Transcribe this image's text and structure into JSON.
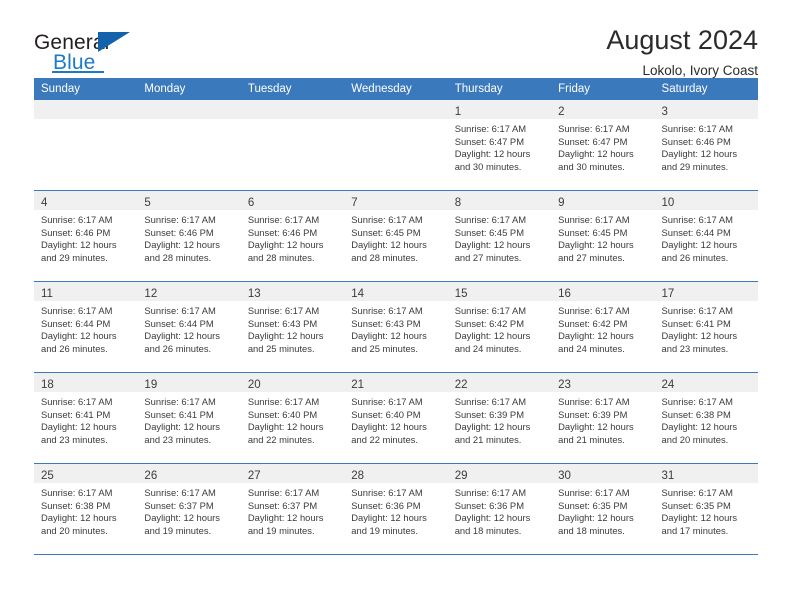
{
  "brand": {
    "name_part1": "General",
    "name_part2": "Blue",
    "flag_icon": "triangle-flag-icon"
  },
  "header": {
    "month_title": "August 2024",
    "location": "Lokolo, Ivory Coast"
  },
  "theme": {
    "header_blue": "#3b79bd",
    "brand_blue": "#1f7ac4",
    "daynum_band": "#f0f0f0",
    "text": "#3b3b3b"
  },
  "calendar": {
    "day_headers": [
      "Sunday",
      "Monday",
      "Tuesday",
      "Wednesday",
      "Thursday",
      "Friday",
      "Saturday"
    ],
    "weeks": [
      [
        {
          "day": "",
          "lines": []
        },
        {
          "day": "",
          "lines": []
        },
        {
          "day": "",
          "lines": []
        },
        {
          "day": "",
          "lines": []
        },
        {
          "day": "1",
          "lines": [
            "Sunrise: 6:17 AM",
            "Sunset: 6:47 PM",
            "Daylight: 12 hours",
            "and 30 minutes."
          ]
        },
        {
          "day": "2",
          "lines": [
            "Sunrise: 6:17 AM",
            "Sunset: 6:47 PM",
            "Daylight: 12 hours",
            "and 30 minutes."
          ]
        },
        {
          "day": "3",
          "lines": [
            "Sunrise: 6:17 AM",
            "Sunset: 6:46 PM",
            "Daylight: 12 hours",
            "and 29 minutes."
          ]
        }
      ],
      [
        {
          "day": "4",
          "lines": [
            "Sunrise: 6:17 AM",
            "Sunset: 6:46 PM",
            "Daylight: 12 hours",
            "and 29 minutes."
          ]
        },
        {
          "day": "5",
          "lines": [
            "Sunrise: 6:17 AM",
            "Sunset: 6:46 PM",
            "Daylight: 12 hours",
            "and 28 minutes."
          ]
        },
        {
          "day": "6",
          "lines": [
            "Sunrise: 6:17 AM",
            "Sunset: 6:46 PM",
            "Daylight: 12 hours",
            "and 28 minutes."
          ]
        },
        {
          "day": "7",
          "lines": [
            "Sunrise: 6:17 AM",
            "Sunset: 6:45 PM",
            "Daylight: 12 hours",
            "and 28 minutes."
          ]
        },
        {
          "day": "8",
          "lines": [
            "Sunrise: 6:17 AM",
            "Sunset: 6:45 PM",
            "Daylight: 12 hours",
            "and 27 minutes."
          ]
        },
        {
          "day": "9",
          "lines": [
            "Sunrise: 6:17 AM",
            "Sunset: 6:45 PM",
            "Daylight: 12 hours",
            "and 27 minutes."
          ]
        },
        {
          "day": "10",
          "lines": [
            "Sunrise: 6:17 AM",
            "Sunset: 6:44 PM",
            "Daylight: 12 hours",
            "and 26 minutes."
          ]
        }
      ],
      [
        {
          "day": "11",
          "lines": [
            "Sunrise: 6:17 AM",
            "Sunset: 6:44 PM",
            "Daylight: 12 hours",
            "and 26 minutes."
          ]
        },
        {
          "day": "12",
          "lines": [
            "Sunrise: 6:17 AM",
            "Sunset: 6:44 PM",
            "Daylight: 12 hours",
            "and 26 minutes."
          ]
        },
        {
          "day": "13",
          "lines": [
            "Sunrise: 6:17 AM",
            "Sunset: 6:43 PM",
            "Daylight: 12 hours",
            "and 25 minutes."
          ]
        },
        {
          "day": "14",
          "lines": [
            "Sunrise: 6:17 AM",
            "Sunset: 6:43 PM",
            "Daylight: 12 hours",
            "and 25 minutes."
          ]
        },
        {
          "day": "15",
          "lines": [
            "Sunrise: 6:17 AM",
            "Sunset: 6:42 PM",
            "Daylight: 12 hours",
            "and 24 minutes."
          ]
        },
        {
          "day": "16",
          "lines": [
            "Sunrise: 6:17 AM",
            "Sunset: 6:42 PM",
            "Daylight: 12 hours",
            "and 24 minutes."
          ]
        },
        {
          "day": "17",
          "lines": [
            "Sunrise: 6:17 AM",
            "Sunset: 6:41 PM",
            "Daylight: 12 hours",
            "and 23 minutes."
          ]
        }
      ],
      [
        {
          "day": "18",
          "lines": [
            "Sunrise: 6:17 AM",
            "Sunset: 6:41 PM",
            "Daylight: 12 hours",
            "and 23 minutes."
          ]
        },
        {
          "day": "19",
          "lines": [
            "Sunrise: 6:17 AM",
            "Sunset: 6:41 PM",
            "Daylight: 12 hours",
            "and 23 minutes."
          ]
        },
        {
          "day": "20",
          "lines": [
            "Sunrise: 6:17 AM",
            "Sunset: 6:40 PM",
            "Daylight: 12 hours",
            "and 22 minutes."
          ]
        },
        {
          "day": "21",
          "lines": [
            "Sunrise: 6:17 AM",
            "Sunset: 6:40 PM",
            "Daylight: 12 hours",
            "and 22 minutes."
          ]
        },
        {
          "day": "22",
          "lines": [
            "Sunrise: 6:17 AM",
            "Sunset: 6:39 PM",
            "Daylight: 12 hours",
            "and 21 minutes."
          ]
        },
        {
          "day": "23",
          "lines": [
            "Sunrise: 6:17 AM",
            "Sunset: 6:39 PM",
            "Daylight: 12 hours",
            "and 21 minutes."
          ]
        },
        {
          "day": "24",
          "lines": [
            "Sunrise: 6:17 AM",
            "Sunset: 6:38 PM",
            "Daylight: 12 hours",
            "and 20 minutes."
          ]
        }
      ],
      [
        {
          "day": "25",
          "lines": [
            "Sunrise: 6:17 AM",
            "Sunset: 6:38 PM",
            "Daylight: 12 hours",
            "and 20 minutes."
          ]
        },
        {
          "day": "26",
          "lines": [
            "Sunrise: 6:17 AM",
            "Sunset: 6:37 PM",
            "Daylight: 12 hours",
            "and 19 minutes."
          ]
        },
        {
          "day": "27",
          "lines": [
            "Sunrise: 6:17 AM",
            "Sunset: 6:37 PM",
            "Daylight: 12 hours",
            "and 19 minutes."
          ]
        },
        {
          "day": "28",
          "lines": [
            "Sunrise: 6:17 AM",
            "Sunset: 6:36 PM",
            "Daylight: 12 hours",
            "and 19 minutes."
          ]
        },
        {
          "day": "29",
          "lines": [
            "Sunrise: 6:17 AM",
            "Sunset: 6:36 PM",
            "Daylight: 12 hours",
            "and 18 minutes."
          ]
        },
        {
          "day": "30",
          "lines": [
            "Sunrise: 6:17 AM",
            "Sunset: 6:35 PM",
            "Daylight: 12 hours",
            "and 18 minutes."
          ]
        },
        {
          "day": "31",
          "lines": [
            "Sunrise: 6:17 AM",
            "Sunset: 6:35 PM",
            "Daylight: 12 hours",
            "and 17 minutes."
          ]
        }
      ]
    ]
  }
}
